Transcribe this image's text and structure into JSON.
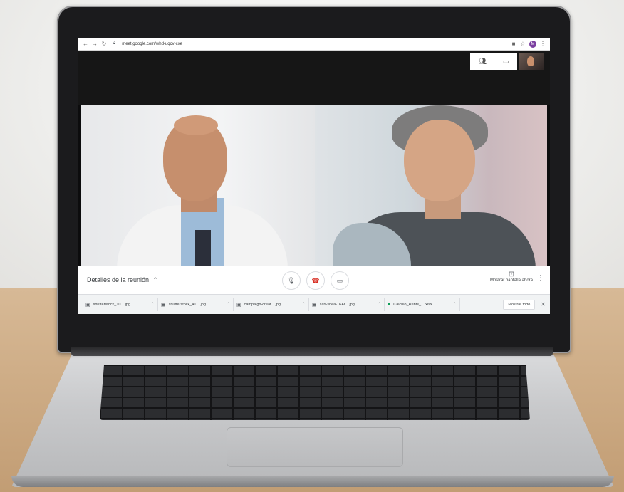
{
  "browser": {
    "url": "meet.google.com/whd-uqcv-cxe",
    "avatar_letter": "M"
  },
  "meeting": {
    "details_label": "Detalles de la reunión",
    "present_label": "Mostrar pantalla ahora"
  },
  "downloads": {
    "items": [
      {
        "name": "shutterstock_10....jpg",
        "icon": "image-file-icon"
      },
      {
        "name": "shutterstock_41....jpg",
        "icon": "image-file-icon"
      },
      {
        "name": "campaign-creat....jpg",
        "icon": "image-file-icon"
      },
      {
        "name": "sarl-shea-16Ar....jpg",
        "icon": "image-file-icon"
      },
      {
        "name": "Cálculo_Rents_....xlsx",
        "icon": "sheet-file-icon"
      }
    ],
    "show_all_label": "Mostrar todo"
  },
  "colors": {
    "hangup": "#d93025",
    "meet_green": "#00897b",
    "sheet_green": "#0f9d58"
  }
}
